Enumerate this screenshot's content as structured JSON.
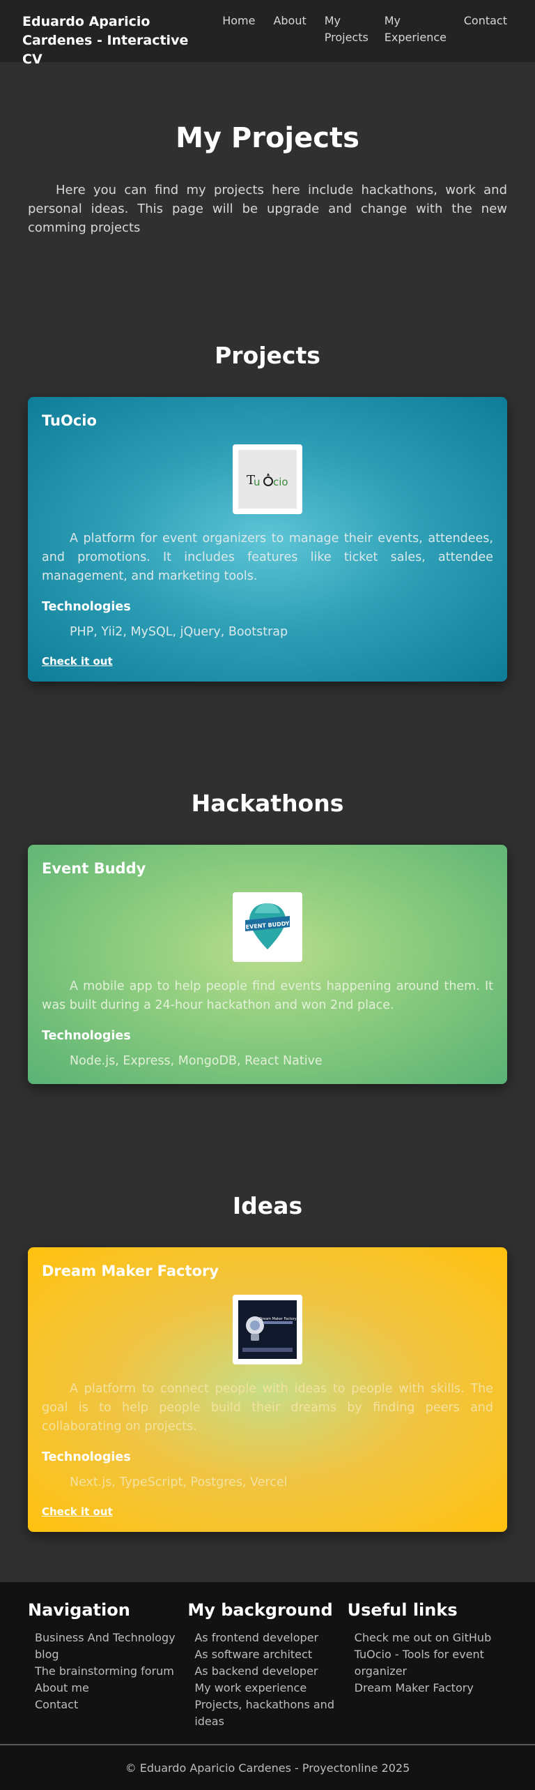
{
  "header": {
    "brand": "Eduardo Aparicio Cardenes - Interactive CV",
    "nav": [
      "Home",
      "About",
      "My Projects",
      "My Experience",
      "Contact"
    ]
  },
  "hero": {
    "title": "My Projects",
    "intro": "Here you can find my projects here include hackathons, work and personal ideas. This page will be upgrade and change with the new comming projects"
  },
  "sections": {
    "projects": {
      "title": "Projects",
      "card": {
        "name": "TuOcio",
        "logo_text": "TuOcio",
        "description": "A platform for event organizers to manage their events, attendees, and promotions. It includes features like ticket sales, attendee management, and marketing tools.",
        "tech_heading": "Technologies",
        "tech": "PHP, Yii2, MySQL, jQuery, Bootstrap",
        "link": "Check it out"
      }
    },
    "hackathons": {
      "title": "Hackathons",
      "card": {
        "name": "Event Buddy",
        "logo_text": "EVENT BUDDY",
        "description": "A mobile app to help people find events happening around them. It was built during a 24-hour hackathon and won 2nd place.",
        "tech_heading": "Technologies",
        "tech": "Node.js, Express, MongoDB, React Native"
      }
    },
    "ideas": {
      "title": "Ideas",
      "card": {
        "name": "Dream Maker Factory",
        "logo_text": "Dream Maker Factory",
        "description": "A platform to connect people with ideas to people with skills. The goal is to help people build their dreams by finding peers and collaborating on projects.",
        "tech_heading": "Technologies",
        "tech": "Next.js, TypeScript, Postgres, Vercel",
        "link": "Check it out"
      }
    }
  },
  "footer": {
    "columns": [
      {
        "title": "Navigation",
        "items": [
          "Business And Technology blog",
          "The brainstorming forum",
          "About me",
          "Contact"
        ]
      },
      {
        "title": "My background",
        "items": [
          "As frontend developer",
          "As software architect",
          "As backend developer",
          "My work experience",
          "Projects, hackathons and ideas"
        ]
      },
      {
        "title": "Useful links",
        "items": [
          "Check me out on GitHub",
          "TuOcio - Tools for event organizer",
          "Dream Maker Factory"
        ]
      }
    ],
    "copyright": "© Eduardo Aparicio Cardenes - Proyectonline 2025"
  },
  "colors": {
    "page_bg": "#303030",
    "header_bg": "#232323",
    "projects_card": "#0e7d98",
    "hackathons_card": "#5ab275",
    "ideas_card": "#ffc20f",
    "footer_bg": "#121212"
  }
}
